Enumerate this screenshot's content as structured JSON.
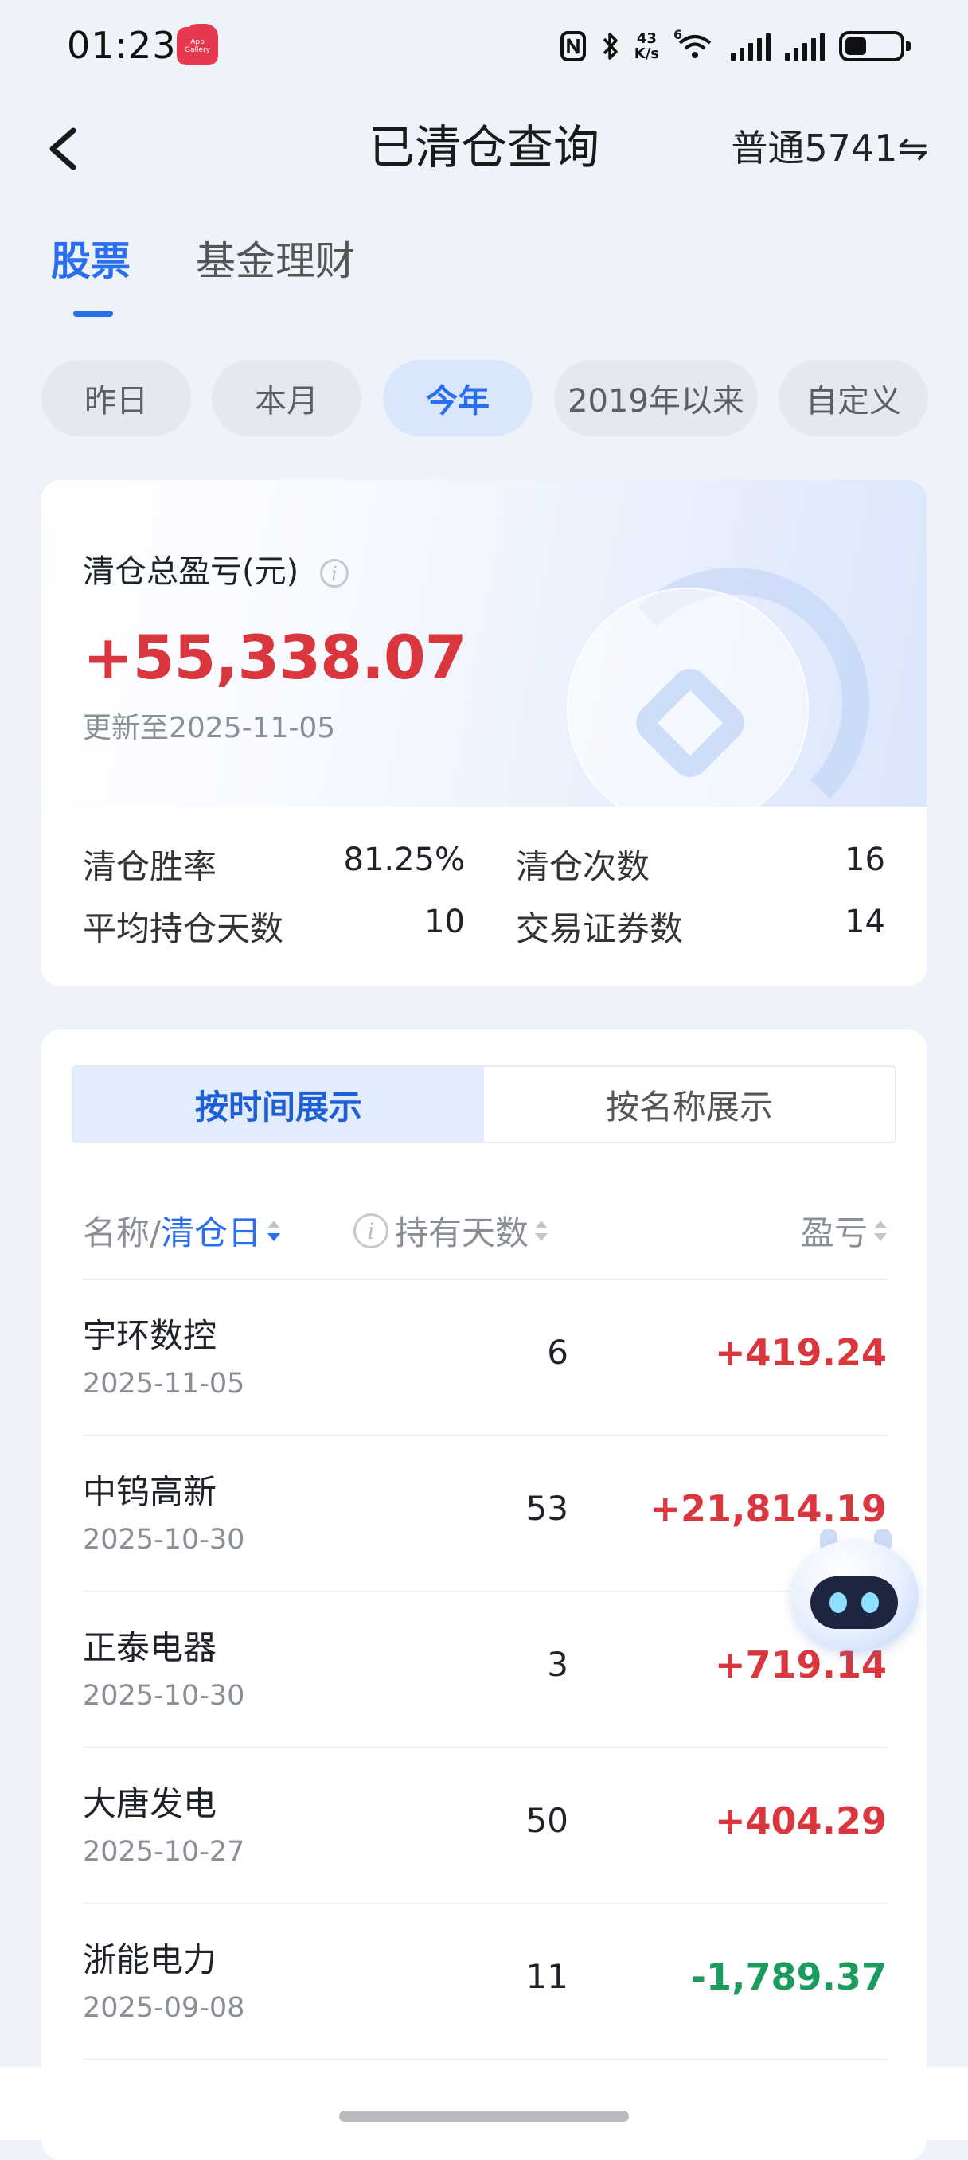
{
  "status_bar": {
    "time": "01:23",
    "app_icon_label": "App Gallery",
    "net_speed_value": "43",
    "net_speed_unit": "K/s",
    "wifi_badge": "6",
    "icons": [
      "nfc-icon",
      "bluetooth-icon",
      "wifi-icon",
      "signal-icon",
      "signal-icon",
      "battery-icon"
    ]
  },
  "header": {
    "title": "已清仓查询",
    "account": "普通5741⇋",
    "back_icon": "back-arrow-icon"
  },
  "category_tabs": [
    {
      "label": "股票",
      "active": true
    },
    {
      "label": "基金理财",
      "active": false
    }
  ],
  "periods": [
    {
      "label": "昨日",
      "active": false
    },
    {
      "label": "本月",
      "active": false
    },
    {
      "label": "今年",
      "active": true
    },
    {
      "label": "2019年以来",
      "active": false
    },
    {
      "label": "自定义",
      "active": false
    }
  ],
  "summary": {
    "label": "清仓总盈亏(元)",
    "info_icon": "info-icon",
    "total": "+55,338.07",
    "updated": "更新至2025-11-05",
    "stats": [
      {
        "label": "清仓胜率",
        "value": "81.25%"
      },
      {
        "label": "清仓次数",
        "value": "16"
      },
      {
        "label": "平均持仓天数",
        "value": "10"
      },
      {
        "label": "交易证券数",
        "value": "14"
      }
    ]
  },
  "view_toggle": {
    "by_time": "按时间展示",
    "by_name": "按名称展示",
    "active": "by_time"
  },
  "columns": {
    "name_prefix": "名称/",
    "name_sort": "清仓日",
    "days": "持有天数",
    "pnl": "盈亏"
  },
  "rows": [
    {
      "name": "宇环数控",
      "date": "2025-11-05",
      "days": "6",
      "pnl": "+419.24",
      "positive": true
    },
    {
      "name": "中钨高新",
      "date": "2025-10-30",
      "days": "53",
      "pnl": "+21,814.19",
      "positive": true
    },
    {
      "name": "正泰电器",
      "date": "2025-10-30",
      "days": "3",
      "pnl": "+719.14",
      "positive": true
    },
    {
      "name": "大唐发电",
      "date": "2025-10-27",
      "days": "50",
      "pnl": "+404.29",
      "positive": true
    },
    {
      "name": "浙能电力",
      "date": "2025-09-08",
      "days": "11",
      "pnl": "-1,789.37",
      "positive": false
    }
  ],
  "colors": {
    "accent": "#2a6ef0",
    "profit": "#d9363e",
    "loss": "#1c9b5e",
    "background": "#eef2f9"
  }
}
